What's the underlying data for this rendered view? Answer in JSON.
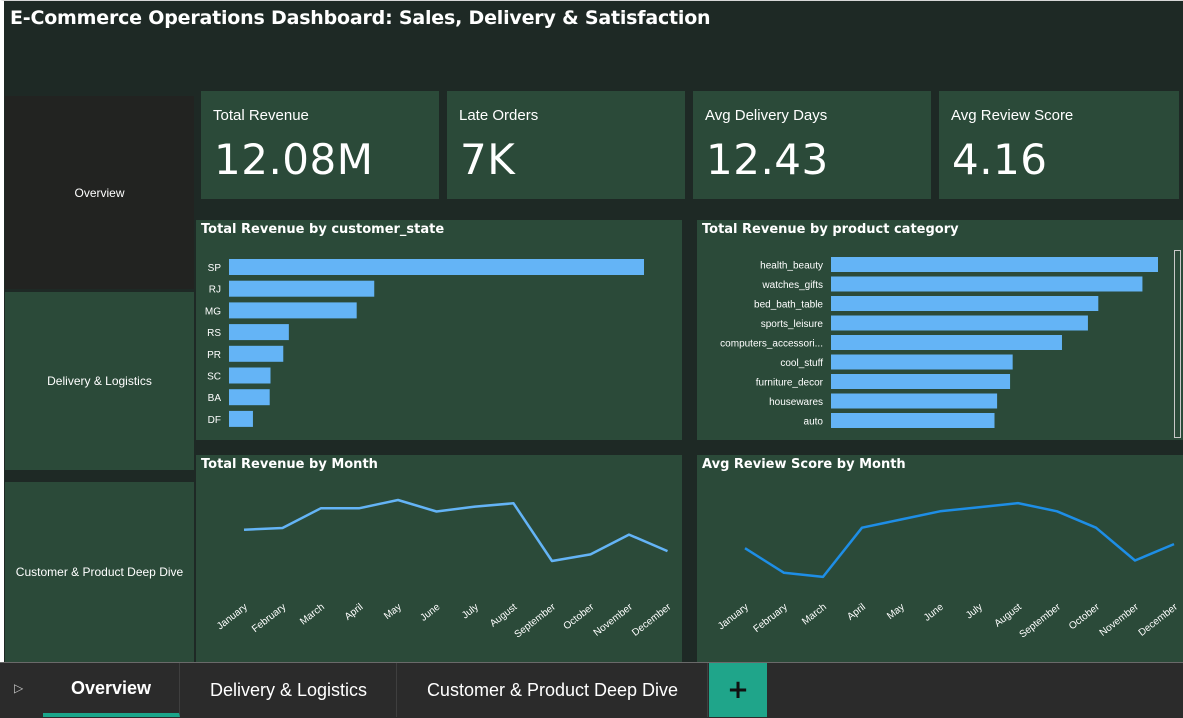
{
  "title": "E-Commerce Operations Dashboard: Sales, Delivery & Satisfaction",
  "nav": [
    {
      "label": "Overview"
    },
    {
      "label": "Delivery & Logistics"
    },
    {
      "label": "Customer & Product Deep Dive"
    }
  ],
  "kpis": [
    {
      "label": "Total Revenue",
      "value": "12.08M"
    },
    {
      "label": "Late Orders",
      "value": "7K"
    },
    {
      "label": "Avg Delivery Days",
      "value": "12.43"
    },
    {
      "label": "Avg Review Score",
      "value": "4.16"
    }
  ],
  "colors": {
    "bar": "#64b4f6",
    "line_revenue": "#64b4f6",
    "line_review": "#1e8ee6",
    "panel": "#2b4a39",
    "accent": "#1fa58a"
  },
  "chart_data": [
    {
      "id": "revenue_by_state",
      "type": "bar",
      "orientation": "horizontal",
      "title": "Total Revenue by customer_state",
      "categories": [
        "SP",
        "RJ",
        "MG",
        "RS",
        "PR",
        "SC",
        "BA",
        "DF"
      ],
      "values": [
        5.2,
        1.82,
        1.6,
        0.75,
        0.68,
        0.52,
        0.51,
        0.3
      ]
    },
    {
      "id": "revenue_by_category",
      "type": "bar",
      "orientation": "horizontal",
      "title": "Total Revenue by product category",
      "categories": [
        "health_beauty",
        "watches_gifts",
        "bed_bath_table",
        "sports_leisure",
        "computers_accessori...",
        "cool_stuff",
        "furniture_decor",
        "housewares",
        "auto"
      ],
      "values": [
        1.26,
        1.2,
        1.03,
        0.99,
        0.89,
        0.7,
        0.69,
        0.64,
        0.63
      ]
    },
    {
      "id": "revenue_by_month",
      "type": "line",
      "title": "Total Revenue by Month",
      "categories": [
        "January",
        "February",
        "March",
        "April",
        "May",
        "June",
        "July",
        "August",
        "September",
        "October",
        "November",
        "December"
      ],
      "values": [
        0.99,
        1.0,
        1.12,
        1.12,
        1.17,
        1.1,
        1.13,
        1.15,
        0.8,
        0.84,
        0.96,
        0.86
      ]
    },
    {
      "id": "review_by_month",
      "type": "line",
      "title": "Avg Review Score by Month",
      "categories": [
        "January",
        "February",
        "March",
        "April",
        "May",
        "June",
        "July",
        "August",
        "September",
        "October",
        "November",
        "December"
      ],
      "values": [
        4.11,
        4.05,
        4.04,
        4.16,
        4.18,
        4.2,
        4.21,
        4.22,
        4.2,
        4.16,
        4.08,
        4.12
      ]
    }
  ],
  "tabs": [
    {
      "label": "Overview",
      "active": true
    },
    {
      "label": "Delivery & Logistics",
      "active": false
    },
    {
      "label": "Customer & Product Deep Dive",
      "active": false
    }
  ],
  "tab_add_label": "+",
  "tab_toggle_icon": "▷"
}
